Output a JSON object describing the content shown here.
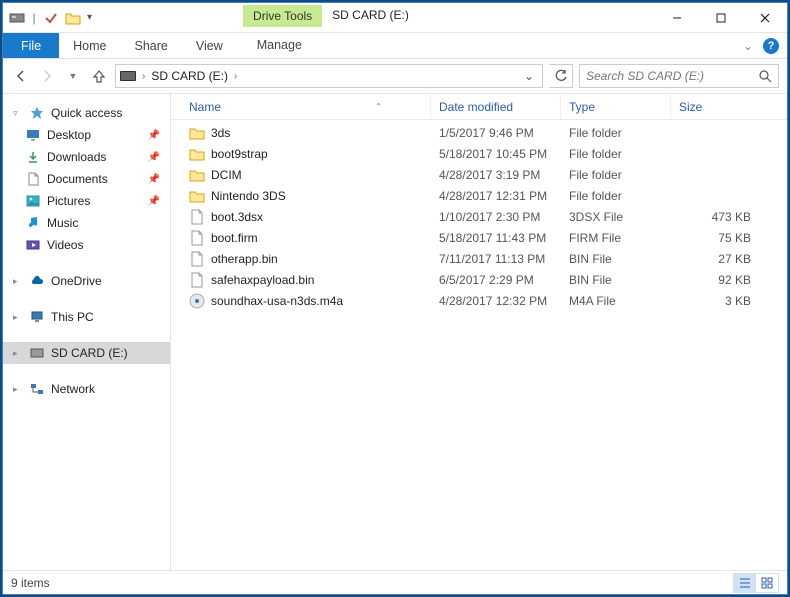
{
  "titlebar": {
    "context_tab_group": "Drive Tools",
    "title": "SD CARD (E:)"
  },
  "ribbon": {
    "file": "File",
    "tabs": [
      "Home",
      "Share",
      "View"
    ],
    "context_tab": "Manage"
  },
  "address": {
    "location": "SD CARD (E:)"
  },
  "search": {
    "placeholder": "Search SD CARD (E:)"
  },
  "navpane": {
    "quick_access": "Quick access",
    "quick_items": [
      {
        "label": "Desktop",
        "pinned": true,
        "icon": "desktop"
      },
      {
        "label": "Downloads",
        "pinned": true,
        "icon": "downloads"
      },
      {
        "label": "Documents",
        "pinned": true,
        "icon": "documents"
      },
      {
        "label": "Pictures",
        "pinned": true,
        "icon": "pictures"
      },
      {
        "label": "Music",
        "pinned": false,
        "icon": "music"
      },
      {
        "label": "Videos",
        "pinned": false,
        "icon": "videos"
      }
    ],
    "onedrive": "OneDrive",
    "thispc": "This PC",
    "sdcard": "SD CARD (E:)",
    "network": "Network"
  },
  "columns": {
    "name": "Name",
    "date": "Date modified",
    "type": "Type",
    "size": "Size"
  },
  "files": [
    {
      "name": "3ds",
      "date": "1/5/2017 9:46 PM",
      "type": "File folder",
      "size": "",
      "icon": "folder"
    },
    {
      "name": "boot9strap",
      "date": "5/18/2017 10:45 PM",
      "type": "File folder",
      "size": "",
      "icon": "folder"
    },
    {
      "name": "DCIM",
      "date": "4/28/2017 3:19 PM",
      "type": "File folder",
      "size": "",
      "icon": "folder"
    },
    {
      "name": "Nintendo 3DS",
      "date": "4/28/2017 12:31 PM",
      "type": "File folder",
      "size": "",
      "icon": "folder"
    },
    {
      "name": "boot.3dsx",
      "date": "1/10/2017 2:30 PM",
      "type": "3DSX File",
      "size": "473 KB",
      "icon": "file"
    },
    {
      "name": "boot.firm",
      "date": "5/18/2017 11:43 PM",
      "type": "FIRM File",
      "size": "75 KB",
      "icon": "file"
    },
    {
      "name": "otherapp.bin",
      "date": "7/11/2017 11:13 PM",
      "type": "BIN File",
      "size": "27 KB",
      "icon": "file"
    },
    {
      "name": "safehaxpayload.bin",
      "date": "6/5/2017 2:29 PM",
      "type": "BIN File",
      "size": "92 KB",
      "icon": "file"
    },
    {
      "name": "soundhax-usa-n3ds.m4a",
      "date": "4/28/2017 12:32 PM",
      "type": "M4A File",
      "size": "3 KB",
      "icon": "audio"
    }
  ],
  "status": {
    "item_count": "9 items"
  }
}
